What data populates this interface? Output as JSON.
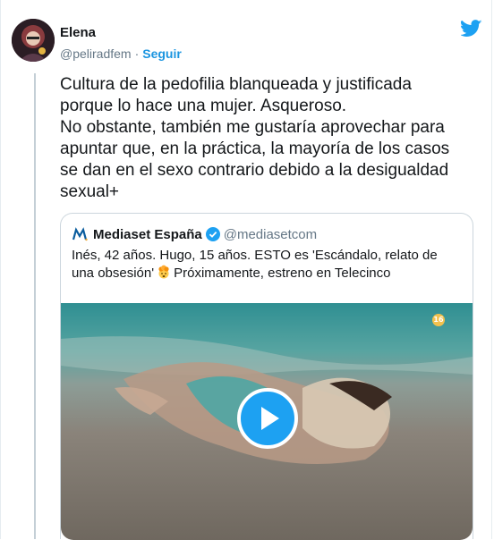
{
  "user": {
    "name": "Elena",
    "handle": "@peliradfem",
    "separator": "·",
    "follow_label": "Seguir"
  },
  "tweet": {
    "text": "Cultura de la pedofilia blanqueada y justificada\nporque lo hace una mujer. Asqueroso.\nNo obstante, también me gustaría aprovechar para\napuntar que, en la práctica, la mayoría de los casos\nse dan en el sexo contrario debido a la desigualdad\nsexual+"
  },
  "quoted": {
    "name": "Mediaset España",
    "handle": "@mediasetcom",
    "text_part1": "Inés, 42 años. Hugo, 15 años. ESTO es 'Escándalo, relato de una obsesión'",
    "text_part2": "Próximamente, estreno en Telecinco",
    "age_rating": "16",
    "logo_letter": "M."
  },
  "colors": {
    "accent": "#1da1f2",
    "follow": "#1b95e0",
    "muted": "#657786",
    "border": "#ccd6dd"
  },
  "icons": [
    "twitter-bird-icon",
    "verified-badge-icon",
    "exploding-head-emoji",
    "play-icon"
  ]
}
